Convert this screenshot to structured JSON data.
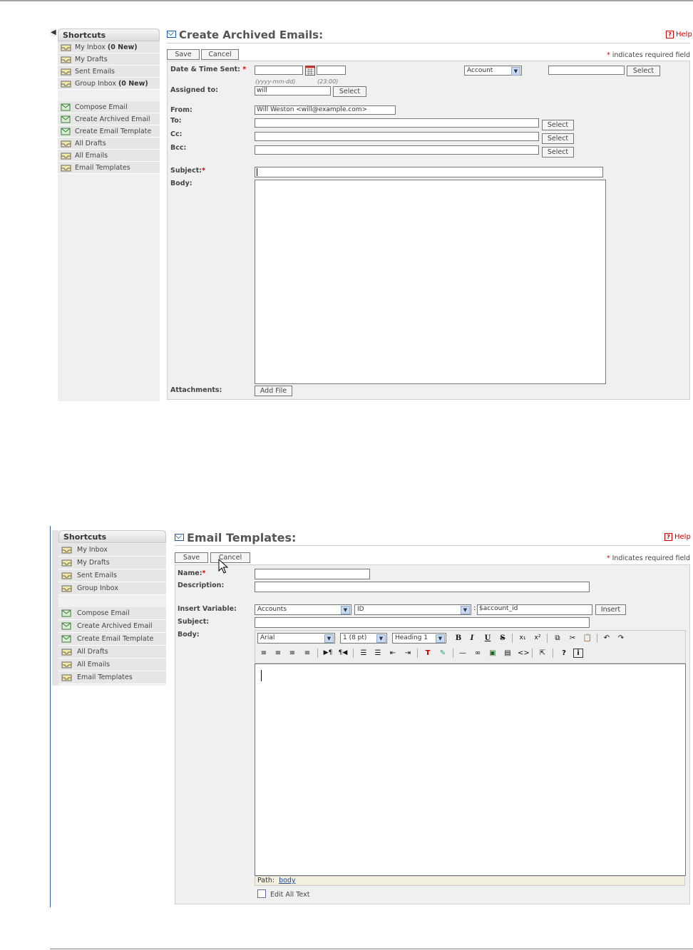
{
  "top_form": {
    "sidebar": {
      "header": "Shortcuts",
      "items": [
        {
          "label": "My Inbox",
          "extra": "(0 New)",
          "icon": "inbox-icon"
        },
        {
          "label": "My Drafts",
          "extra": "",
          "icon": "inbox-icon"
        },
        {
          "label": "Sent Emails",
          "extra": "",
          "icon": "inbox-icon"
        },
        {
          "label": "Group Inbox",
          "extra": "(0 New)",
          "icon": "inbox-icon"
        },
        {
          "label": "Compose Email",
          "extra": "",
          "icon": "compose-icon"
        },
        {
          "label": "Create Archived Email",
          "extra": "",
          "icon": "compose-icon"
        },
        {
          "label": "Create Email Template",
          "extra": "",
          "icon": "compose-icon"
        },
        {
          "label": "All Drafts",
          "extra": "",
          "icon": "inbox-icon"
        },
        {
          "label": "All Emails",
          "extra": "",
          "icon": "inbox-icon"
        },
        {
          "label": "Email Templates",
          "extra": "",
          "icon": "inbox-icon"
        }
      ]
    },
    "title": "Create Archived Emails:",
    "help": "Help",
    "save_label": "Save",
    "cancel_label": "Cancel",
    "required_note": "indicates required field",
    "labels": {
      "date_time": "Date & Time Sent:",
      "assigned_to": "Assigned to:",
      "from": "From:",
      "to": "To:",
      "cc": "Cc:",
      "bcc": "Bcc:",
      "subject": "Subject:",
      "body": "Body:",
      "attachments": "Attachments:"
    },
    "date_hint": "(yyyy-mm-dd)",
    "time_hint": "(23:00)",
    "parent_type_selected": "Account",
    "assigned_value": "will",
    "from_value": "Will Weston <will@example.com>",
    "select_label": "Select",
    "add_file_label": "Add File"
  },
  "bottom_form": {
    "sidebar": {
      "header": "Shortcuts",
      "items": [
        {
          "label": "My Inbox",
          "icon": "inbox-icon"
        },
        {
          "label": "My Drafts",
          "icon": "inbox-icon"
        },
        {
          "label": "Sent Emails",
          "icon": "inbox-icon"
        },
        {
          "label": "Group Inbox",
          "icon": "inbox-icon"
        },
        {
          "label": "Compose Email",
          "icon": "compose-icon"
        },
        {
          "label": "Create Archived Email",
          "icon": "compose-icon"
        },
        {
          "label": "Create Email Template",
          "icon": "compose-icon"
        },
        {
          "label": "All Drafts",
          "icon": "inbox-icon"
        },
        {
          "label": "All Emails",
          "icon": "inbox-icon"
        },
        {
          "label": "Email Templates",
          "icon": "inbox-icon"
        }
      ]
    },
    "title": "Email Templates:",
    "help": "Help",
    "save_label": "Save",
    "cancel_label": "Cancel",
    "required_note": "Indicates required field",
    "labels": {
      "name": "Name:",
      "description": "Description:",
      "insert_variable": "Insert Variable:",
      "subject": "Subject:",
      "body": "Body:"
    },
    "variable_module": "Accounts",
    "variable_field": "ID",
    "variable_value": "$account_id",
    "insert_label": "Insert",
    "editor": {
      "font": "Arial",
      "size": "1 (8 pt)",
      "format": "Heading 1",
      "path_label": "Path:",
      "path_value": "body",
      "edit_all_text": "Edit All Text"
    }
  }
}
